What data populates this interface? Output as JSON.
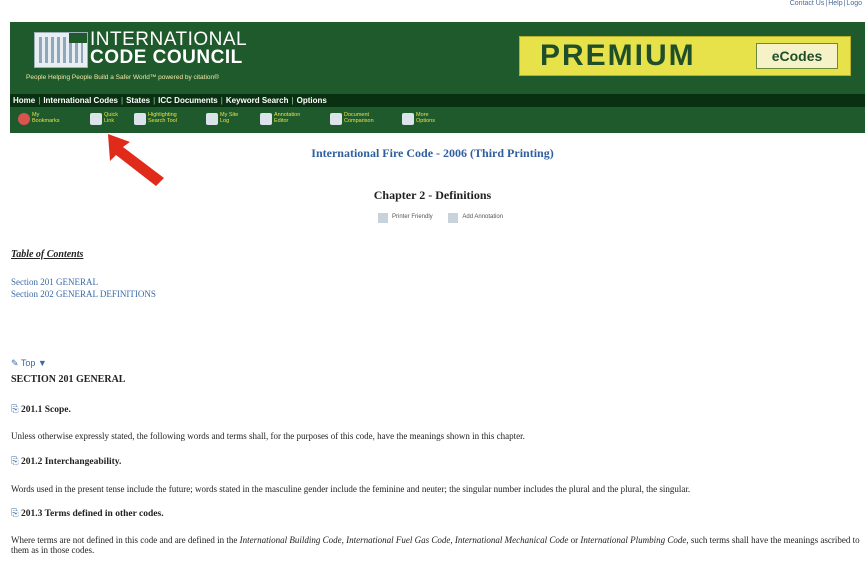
{
  "top_links": [
    "Contact Us",
    "Help",
    "Logo"
  ],
  "banner": {
    "org_name_line1": "INTERNATIONAL",
    "org_name_line2": "CODE COUNCIL",
    "logo_corner": "ICC",
    "tagline": "People Helping People Build a Safer World™   powered by citation®",
    "premium_word": "PREMIUM",
    "ecodes_label": "eCodes"
  },
  "nav": {
    "items": [
      "Home",
      "International Codes",
      "States",
      "ICC Documents",
      "Keyword Search",
      "Options"
    ]
  },
  "toolbar": {
    "items": [
      {
        "line1": "My",
        "line2": "Bookmarks",
        "icon": "bookmark-icon"
      },
      {
        "line1": "Quick",
        "line2": "Link",
        "icon": "quick-link-icon"
      },
      {
        "line1": "Highlighting",
        "line2": "Search Tool",
        "icon": "highlight-icon"
      },
      {
        "line1": "My Site",
        "line2": "Log",
        "icon": "site-log-icon"
      },
      {
        "line1": "Annotation",
        "line2": "Editor",
        "icon": "annotation-icon"
      },
      {
        "line1": "Document",
        "line2": "Comparison",
        "icon": "compare-icon"
      },
      {
        "line1": "More",
        "line2": "Options",
        "icon": "options-icon"
      }
    ]
  },
  "document": {
    "book_title": "International Fire Code - 2006 (Third Printing)",
    "chapter_title": "Chapter 2 - Definitions",
    "actions": {
      "printer": "Printer Friendly",
      "annotation": "Add Annotation"
    },
    "toc_heading": "Table of Contents",
    "toc": [
      "Section 201  GENERAL",
      "Section 202  GENERAL DEFINITIONS"
    ],
    "top_label": "Top",
    "section_heading": "SECTION 201 GENERAL",
    "subsections": [
      {
        "heading": "201.1 Scope.",
        "text": "Unless otherwise expressly stated, the following words and terms shall, for the purposes of this code, have the meanings shown in this chapter."
      },
      {
        "heading": "201.2 Interchangeability.",
        "text": "Words used in the present tense include the future; words stated in the masculine gender include the feminine and neuter; the singular number includes the plural and the plural, the singular."
      },
      {
        "heading": "201.3 Terms defined in other codes.",
        "text_prefix": "Where terms are not defined in this code and are defined in the ",
        "codes": "International Building Code, International Fuel Gas Code, International Mechanical Code",
        "text_mid": " or ",
        "code_last": "International Plumbing Code",
        "text_suffix": ", such terms shall have the meanings ascribed to them as in those codes."
      }
    ]
  },
  "colors": {
    "banner_green": "#1f5a2c",
    "premium_yellow": "#e8e24a",
    "link_blue": "#3a69a7",
    "arrow_red": "#e02a1a"
  }
}
